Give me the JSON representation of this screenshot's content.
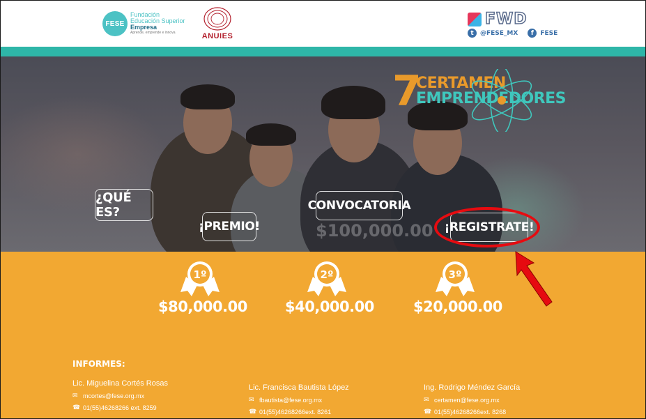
{
  "header": {
    "fese": {
      "abbr": "FESE",
      "line1": "Fundación",
      "line2": "Educación Superior",
      "line3": "Empresa",
      "tagline": "Aprende, emprende e innova"
    },
    "anuies": "ANUIES",
    "fwd": "FWD",
    "twitter_handle": "@FESE_MX",
    "facebook_handle": "FESE"
  },
  "hero": {
    "certamen_number": "7",
    "certamen_line1": "CERTAMEN",
    "certamen_line2": "EMPRENDEDORES",
    "buttons": {
      "que_es": "¿QUÉ ES?",
      "premio": "¡PREMIO!",
      "convocatoria": "CONVOCATORIA",
      "registrate": "¡REGISTRATE!"
    },
    "background_amount": "$100,000.00"
  },
  "prizes": [
    {
      "place": "1º",
      "amount": "$80,000.00"
    },
    {
      "place": "2º",
      "amount": "$40,000.00"
    },
    {
      "place": "3º",
      "amount": "$20,000.00"
    }
  ],
  "informes": {
    "title": "INFORMES:",
    "contacts": [
      {
        "name": "Lic. Miguelina Cortés Rosas",
        "email": "mcortes@fese.org.mx",
        "phone": "01(55)46268266 ext. 8259"
      },
      {
        "name": "Lic. Francisca Bautista López",
        "email": "fbautista@fese.org.mx",
        "phone": "01(55)46268266ext. 8261"
      },
      {
        "name": "Ing. Rodrigo Méndez García",
        "email": "certamen@fese.org.mx",
        "phone": "01(55)46268266ext. 8268"
      }
    ]
  },
  "colors": {
    "teal": "#2eb6a8",
    "orange": "#f2a832",
    "highlight_red": "#e60b10"
  }
}
